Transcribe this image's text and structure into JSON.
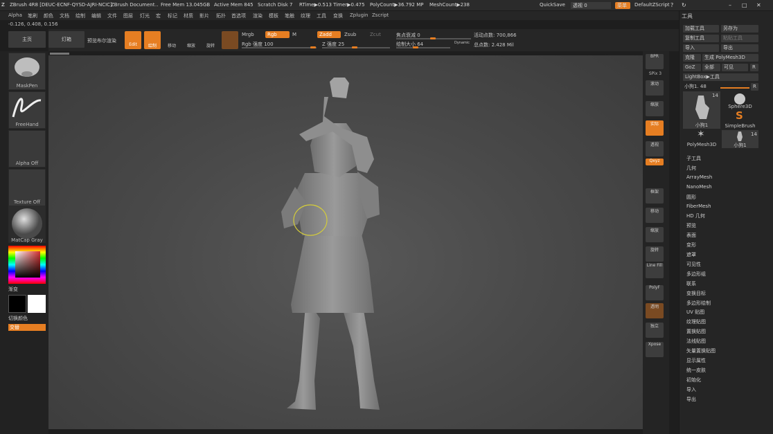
{
  "titlebar": {
    "app": "ZBrush 4R8 [DEUC-ECNF-QYSD-AJRI-NCIC]",
    "document": "ZBrush Document",
    "dots": "..",
    "free_mem": "Free Mem 13.045GB",
    "active_mem": "Active Mem 845",
    "scratch": "Scratch Disk 7",
    "rtime": "RTime▶0.513 Timer▶0.475",
    "polycount": "PolyCount▶36.792 MP",
    "meshcount": "MeshCount▶238",
    "quicksave": "QuickSave",
    "transparency": "透视 0",
    "menu_btn": "菜单",
    "script": "DefaultZScript"
  },
  "menubar": [
    "Alpha",
    "笔刷",
    "颜色",
    "文档",
    "绘制",
    "编辑",
    "文件",
    "图层",
    "灯光",
    "宏",
    "标记",
    "材质",
    "影片",
    "拓扑",
    "首选项",
    "渲染",
    "模板",
    "笔触",
    "纹理",
    "工具",
    "变换",
    "Zplugin",
    "Zscript"
  ],
  "coords": "-0.126, 0.408, 0.156",
  "shelf": {
    "home": "主页",
    "lightbox": "灯箱",
    "bpr": "预览布尔渲染",
    "edit": "Edit",
    "draw": "绘制",
    "move": "移动",
    "scale": "缩放",
    "rotate": "旋转",
    "mrgb": "Mrgb",
    "rgb": "Rgb",
    "m": "M",
    "zadd": "Zadd",
    "zsub": "Zsub",
    "zcut": "Zcut",
    "rgb_intensity": "Rgb 强度 100",
    "z_intensity": "Z 强度 25",
    "focal_shift": "焦点衰减 0",
    "draw_size": "绘制大小 64",
    "dynamic": "Dynamic",
    "active_points": "活动点数: 700,866",
    "total_points": "总点数: 2.428 Mil"
  },
  "lefttray": {
    "brush": "MaskPen",
    "stroke": "FreeHand",
    "alpha": "Alpha Off",
    "texture": "Texture Off",
    "material": "MatCap Gray",
    "gradient": "渐变",
    "switch_color": "切换颜色",
    "alternate": "交替"
  },
  "rightstrip": {
    "bpr": "BPR",
    "spix": "SPix 3",
    "scroll": "滚动",
    "zoom": "缩放",
    "actual": "实际",
    "persp": "透视",
    "floor": "地面",
    "xyz": "Qxyz",
    "frame": "框架",
    "move": "移动",
    "scale": "缩放",
    "rotate": "旋转",
    "linefill": "Line Fill",
    "polyf": "PolyF",
    "transp": "透明",
    "ghost": "Dynamic",
    "solo": "独立",
    "xpose": "Xpose"
  },
  "palette": {
    "title": "工具",
    "load": "加载工具",
    "save_as": "另存为",
    "copy": "复制工具",
    "paste": "粘贴工具",
    "import": "导入",
    "export": "导出",
    "clone": "克隆",
    "make_polymesh": "生成 PolyMesh3D",
    "goz": "GoZ",
    "all": "全部",
    "visible": "可见",
    "r": "R",
    "lightbox_tools": "LightBox▶工具",
    "current_tool": "小狗1. 48",
    "r2": "R",
    "thumb_count1": "14",
    "thumb_count2": "14",
    "thumbs": [
      "小狗1",
      "Sphere3D",
      "SimpleBrush",
      "PolyMesh3D",
      "小狗1"
    ],
    "items": [
      "子工具",
      "几何",
      "ArrayMesh",
      "NanoMesh",
      "圆形",
      "FiberMesh",
      "HD 几何",
      "预览",
      "表面",
      "变形",
      "遮罩",
      "可见性",
      "多边形组",
      "联系",
      "变换目标",
      "多边形绘制",
      "UV 贴图",
      "纹理贴图",
      "置换贴图",
      "法线贴图",
      "矢量置换贴图",
      "显示属性",
      "统一皮肤",
      "初始化",
      "导入",
      "导出"
    ]
  },
  "colors": {
    "accent": "#e67e22",
    "panel": "#252525",
    "viewport": "#4a4a4a",
    "model": "#8c8c8c"
  }
}
